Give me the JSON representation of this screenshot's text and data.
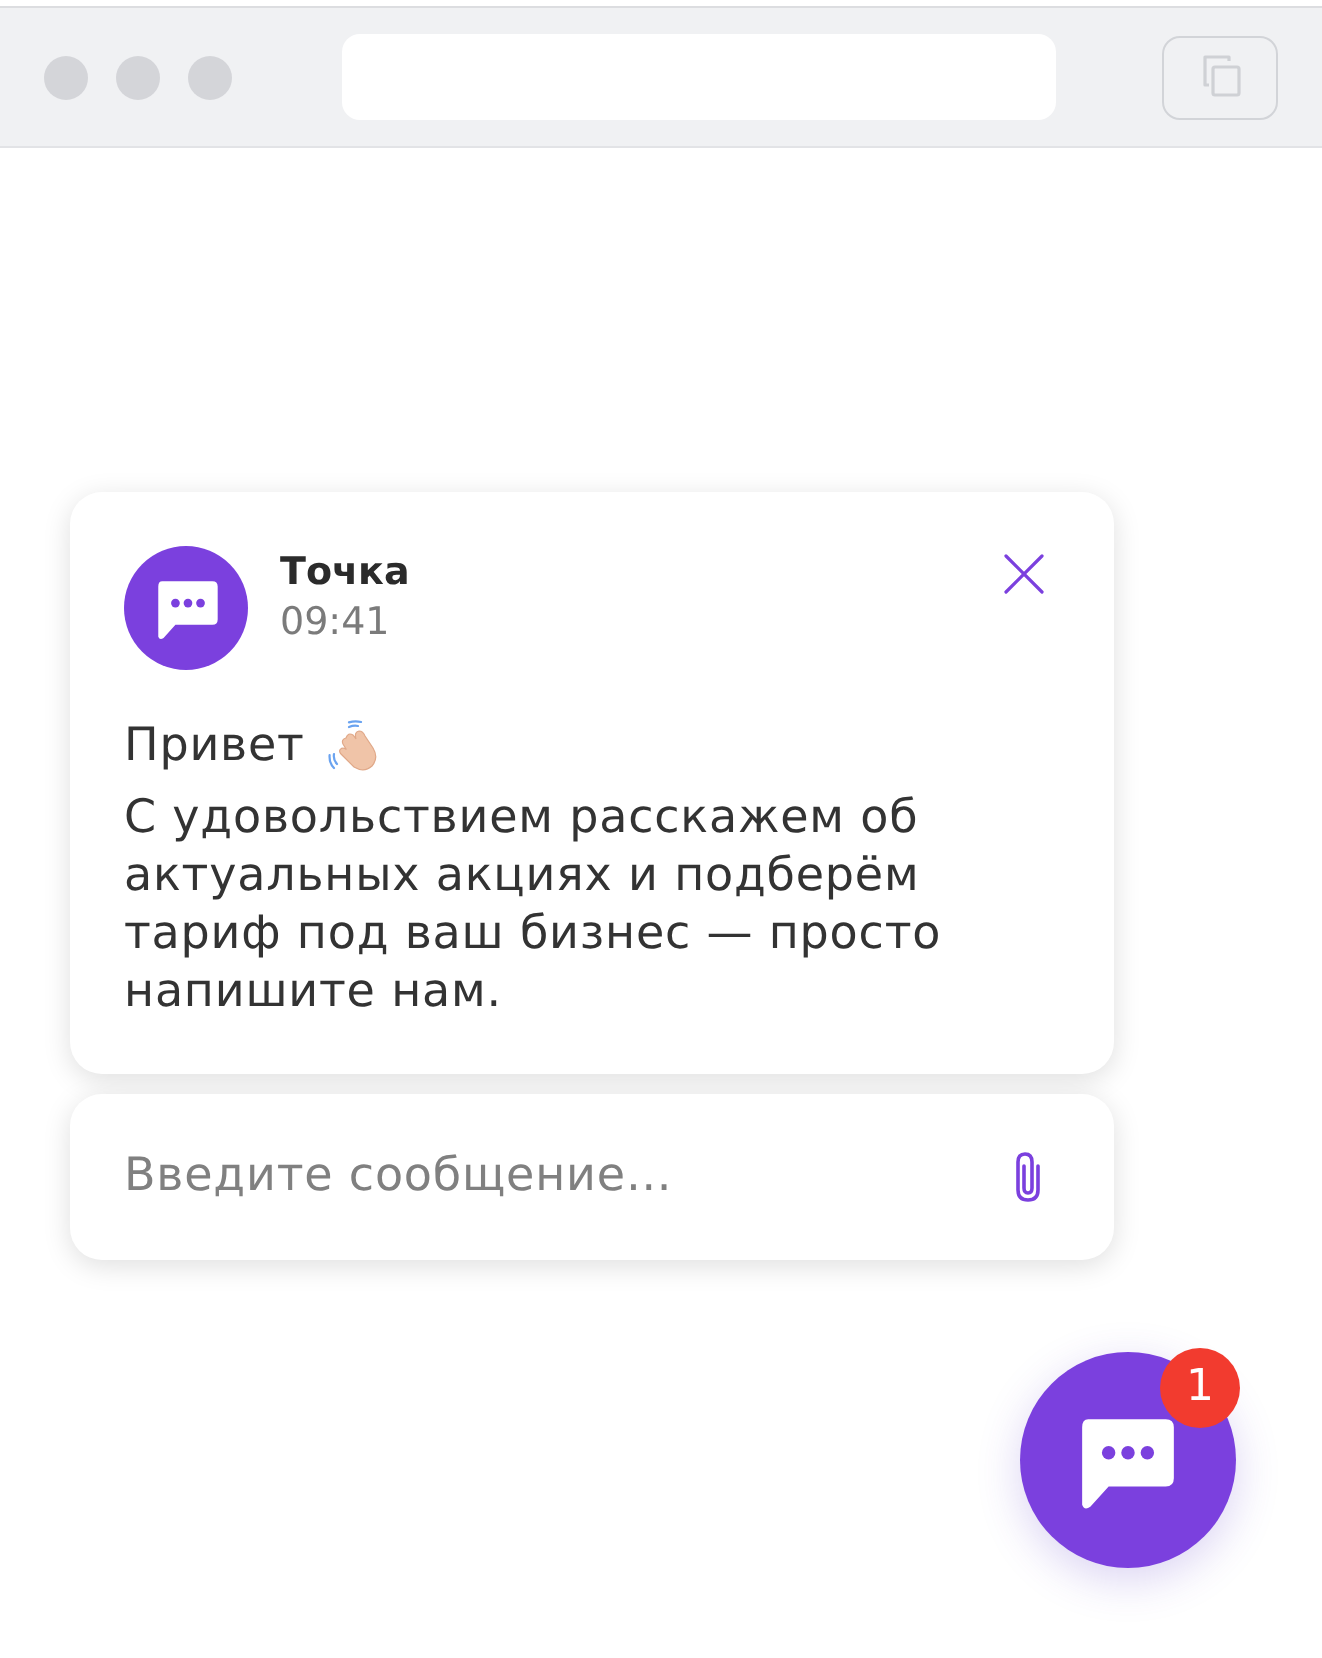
{
  "chat_popup": {
    "sender": "Точка",
    "time": "09:41",
    "greeting": "Привет",
    "message": "С удовольствием расскажем об актуальных акциях и подберём тариф под ваш бизнес — просто напишите нам."
  },
  "composer": {
    "placeholder": "Введите сообщение…"
  },
  "launcher": {
    "badge": "1"
  }
}
